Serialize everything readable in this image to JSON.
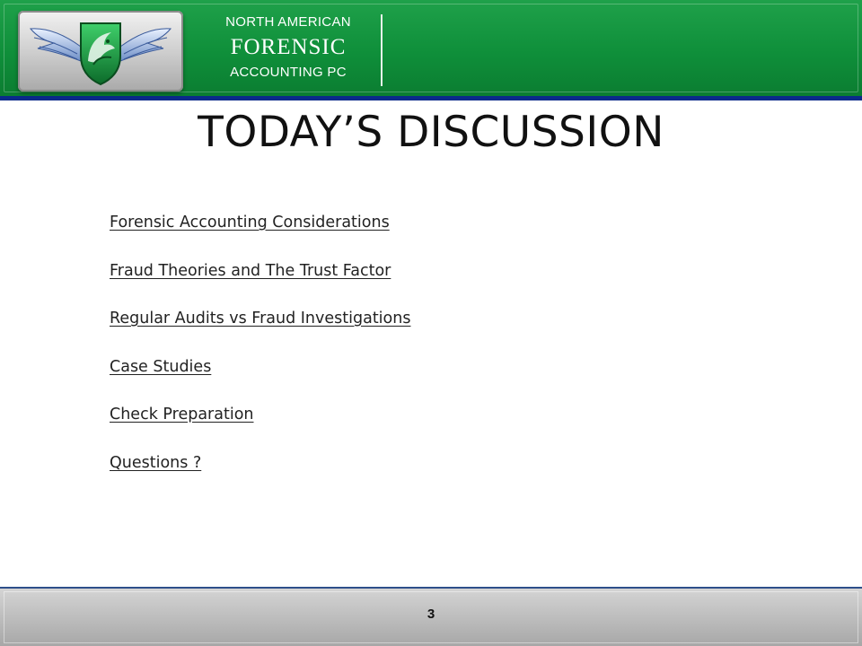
{
  "header": {
    "company_line1": "NORTH AMERICAN",
    "company_line2": "FORENSIC",
    "company_line3": "ACCOUNTING PC",
    "colors": {
      "band": "#0f8f3a",
      "border": "#0b2a8a"
    },
    "logo_icon": "eagle-emblem-icon"
  },
  "slide": {
    "title": "TODAY’S DISCUSSION",
    "agenda": [
      "Forensic Accounting Considerations",
      "Fraud Theories and The Trust Factor",
      "Regular Audits vs Fraud Investigations",
      "Case Studies",
      "Check Preparation",
      "Questions ?"
    ]
  },
  "footer": {
    "page_number": "3"
  }
}
